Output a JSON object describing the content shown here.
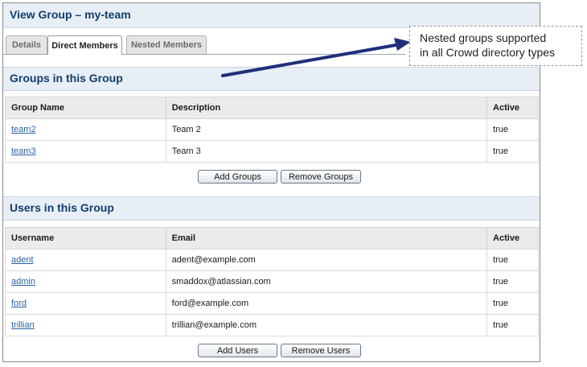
{
  "header": {
    "title": "View Group  –  my-team"
  },
  "tabs": [
    {
      "label": "Details"
    },
    {
      "label": "Direct Members"
    },
    {
      "label": "Nested Members"
    }
  ],
  "groups_section": {
    "title": "Groups in this Group",
    "columns": [
      "Group Name",
      "Description",
      "Active"
    ],
    "rows": [
      {
        "name": "team2",
        "description": "Team 2",
        "active": "true"
      },
      {
        "name": "team3",
        "description": "Team 3",
        "active": "true"
      }
    ],
    "add_button": "Add Groups",
    "remove_button": "Remove Groups"
  },
  "users_section": {
    "title": "Users in this Group",
    "columns": [
      "Username",
      "Email",
      "Active"
    ],
    "rows": [
      {
        "username": "adent",
        "email": "adent@example.com",
        "active": "true"
      },
      {
        "username": "admin",
        "email": "smaddox@atlassian.com",
        "active": "true"
      },
      {
        "username": "ford",
        "email": "ford@example.com",
        "active": "true"
      },
      {
        "username": "trillian",
        "email": "trillian@example.com",
        "active": "true"
      }
    ],
    "add_button": "Add Users",
    "remove_button": "Remove Users"
  },
  "callout": {
    "line1": "Nested groups supported",
    "line2": "in all Crowd directory types"
  },
  "colors": {
    "heading": "#123e6d",
    "link": "#2a63a3",
    "bar": "#e7eef6",
    "arrow": "#1f2f7a"
  }
}
